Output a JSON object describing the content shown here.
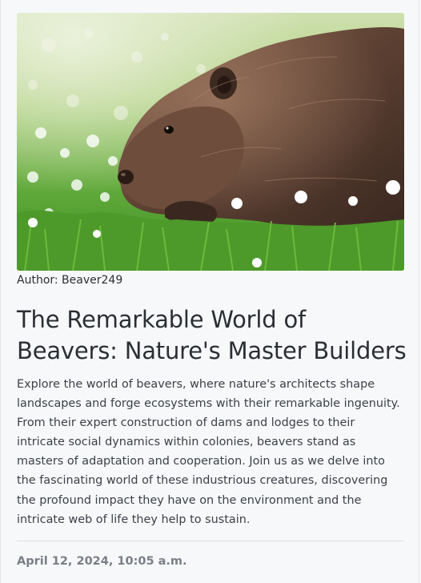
{
  "post": {
    "image_subject": "beaver",
    "author_label": "Author: Beaver249",
    "title": "The Remarkable World of Beavers: Nature's Master Builders",
    "description": "Explore the world of beavers, where nature's architects shape landscapes and forge ecosystems with their remarkable ingenuity. From their expert construction of dams and lodges to their intricate social dynamics within colonies, beavers stand as masters of adaptation and cooperation. Join us as we delve into the fascinating world of these industrious creatures, discovering the profound impact they have on the environment and the intricate web of life they help to sustain.",
    "date": "April 12, 2024, 10:05 a.m."
  }
}
